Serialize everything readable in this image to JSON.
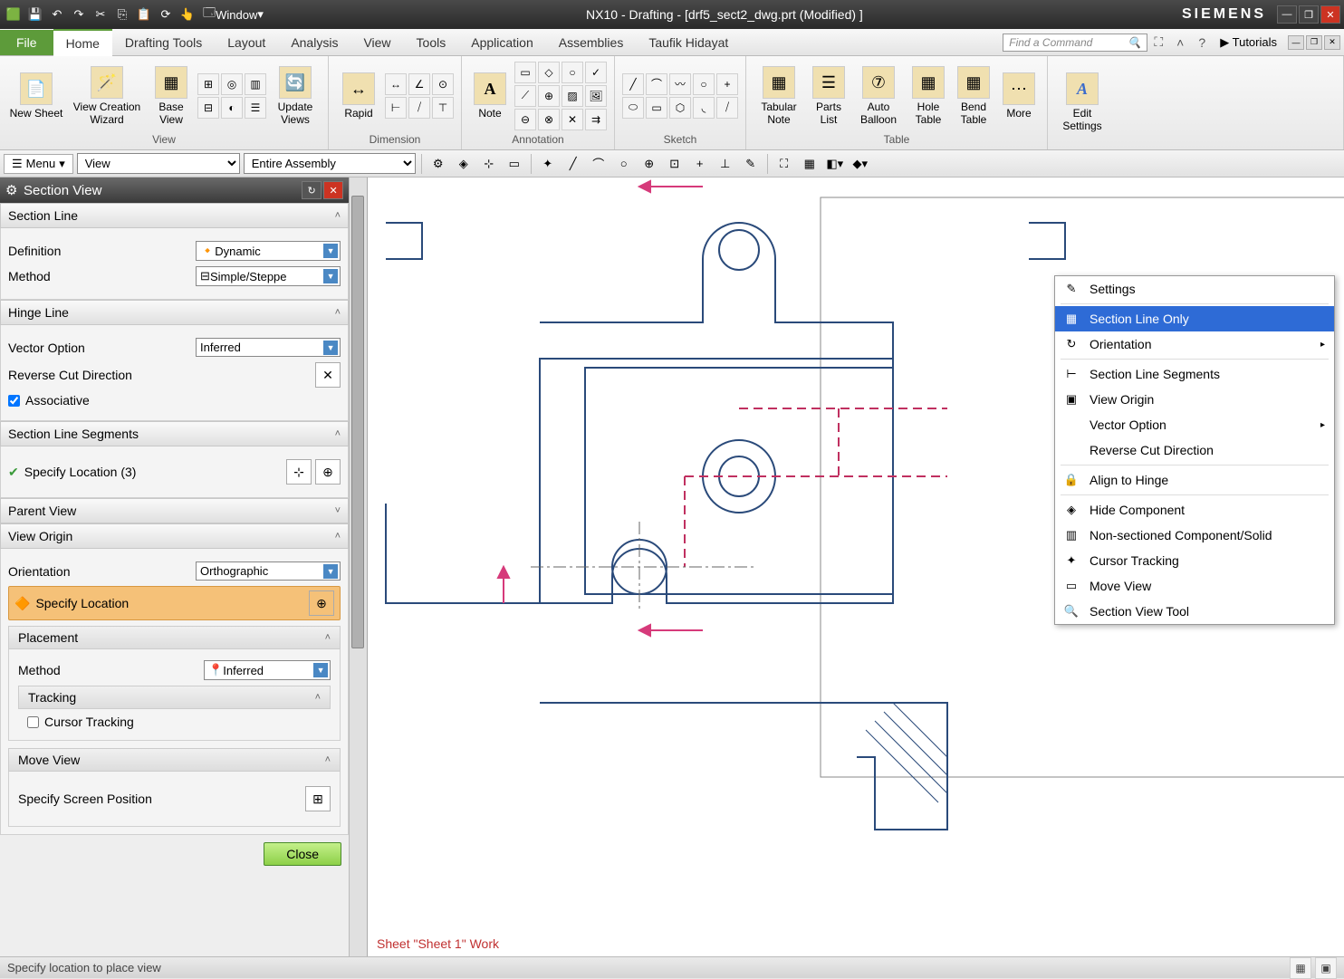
{
  "titlebar": {
    "center": "NX10 - Drafting - [drf5_sect2_dwg.prt (Modified) ]",
    "brand": "SIEMENS",
    "window_menu": "Window"
  },
  "tabs": {
    "file": "File",
    "items": [
      "Home",
      "Drafting Tools",
      "Layout",
      "Analysis",
      "View",
      "Tools",
      "Application",
      "Assemblies",
      "Taufik Hidayat"
    ],
    "active": "Home",
    "search_placeholder": "Find a Command",
    "tutorials": "Tutorials"
  },
  "ribbon": {
    "groups": [
      {
        "label": "View",
        "buttons": [
          "New Sheet",
          "View Creation Wizard",
          "Base View",
          "Update Views"
        ]
      },
      {
        "label": "Dimension",
        "buttons": [
          "Rapid"
        ]
      },
      {
        "label": "Annotation",
        "buttons": [
          "Note"
        ]
      },
      {
        "label": "Sketch",
        "buttons": []
      },
      {
        "label": "Table",
        "buttons": [
          "Tabular Note",
          "Parts List",
          "Auto Balloon",
          "Hole Table",
          "Bend Table",
          "More"
        ]
      },
      {
        "label": "",
        "buttons": [
          "Edit Settings"
        ]
      }
    ]
  },
  "toolbar2": {
    "menu": "Menu",
    "select1": "View",
    "select2": "Entire Assembly"
  },
  "panel": {
    "title": "Section View",
    "sections": {
      "section_line": {
        "title": "Section Line",
        "definition_label": "Definition",
        "definition_value": "Dynamic",
        "method_label": "Method",
        "method_value": "Simple/Steppe"
      },
      "hinge_line": {
        "title": "Hinge Line",
        "vector_label": "Vector Option",
        "vector_value": "Inferred",
        "reverse_label": "Reverse Cut Direction",
        "assoc_label": "Associative"
      },
      "segments": {
        "title": "Section Line Segments",
        "specify": "Specify Location (3)"
      },
      "parent_view": {
        "title": "Parent View"
      },
      "view_origin": {
        "title": "View Origin",
        "orientation_label": "Orientation",
        "orientation_value": "Orthographic",
        "specify_location": "Specify Location",
        "placement_title": "Placement",
        "placement_method_label": "Method",
        "placement_method_value": "Inferred",
        "tracking_title": "Tracking",
        "cursor_tracking": "Cursor Tracking",
        "move_view_title": "Move View",
        "screen_pos": "Specify Screen Position"
      }
    },
    "close": "Close"
  },
  "context_menu": {
    "items": [
      {
        "label": "Settings",
        "icon": "✎"
      },
      {
        "label": "Section Line Only",
        "icon": "▦",
        "hl": true
      },
      {
        "label": "Orientation",
        "icon": "↻",
        "sub": true
      },
      {
        "label": "Section Line Segments",
        "icon": "⊢"
      },
      {
        "label": "View Origin",
        "icon": "▣"
      },
      {
        "label": "Vector Option",
        "icon": "",
        "sub": true
      },
      {
        "label": "Reverse Cut Direction",
        "icon": ""
      },
      {
        "label": "Align to Hinge",
        "icon": "🔒",
        "sep_before": true
      },
      {
        "label": "Hide Component",
        "icon": "◈",
        "sep_before": true
      },
      {
        "label": "Non-sectioned Component/Solid",
        "icon": "▥"
      },
      {
        "label": "Cursor Tracking",
        "icon": "✦"
      },
      {
        "label": "Move View",
        "icon": "▭"
      },
      {
        "label": "Section View Tool",
        "icon": "🔍"
      }
    ]
  },
  "canvas": {
    "sheet_label": "Sheet \"Sheet 1\" Work"
  },
  "statusbar": {
    "msg": "Specify location to place view"
  }
}
